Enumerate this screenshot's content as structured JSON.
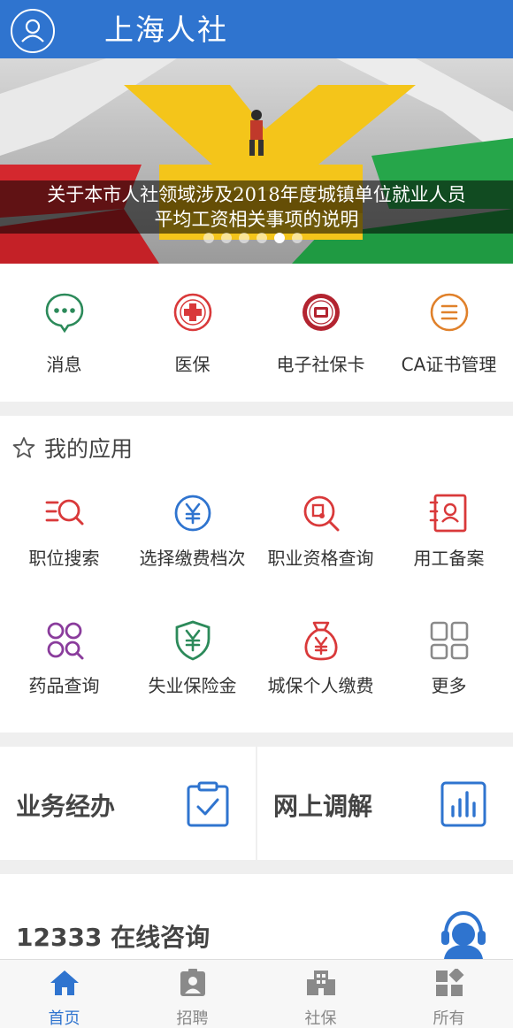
{
  "header": {
    "title": "上海人社",
    "avatar_icon": "user-icon"
  },
  "banner": {
    "caption_line1": "关于本市人社领域涉及2018年度城镇单位就业人员",
    "caption_line2": "平均工资相关事项的说明",
    "slide_count": 6,
    "active_slide": 4
  },
  "quick_actions": [
    {
      "label": "消息",
      "icon": "chat-bubble-icon",
      "color": "#2c8a5a"
    },
    {
      "label": "医保",
      "icon": "medical-cross-icon",
      "color": "#d9393a"
    },
    {
      "label": "电子社保卡",
      "icon": "social-security-seal-icon",
      "color": "#b32430"
    },
    {
      "label": "CA证书管理",
      "icon": "list-icon",
      "color": "#e0812b"
    }
  ],
  "my_apps": {
    "title": "我的应用",
    "icon": "star-icon",
    "items": [
      {
        "label": "职位搜索",
        "icon": "list-search-icon"
      },
      {
        "label": "选择缴费档次",
        "icon": "yuan-circle-icon"
      },
      {
        "label": "职业资格查询",
        "icon": "certificate-search-icon"
      },
      {
        "label": "用工备案",
        "icon": "id-card-icon"
      },
      {
        "label": "药品查询",
        "icon": "pills-search-icon"
      },
      {
        "label": "失业保险金",
        "icon": "yuan-shield-icon"
      },
      {
        "label": "城保个人缴费",
        "icon": "money-bag-icon"
      },
      {
        "label": "更多",
        "icon": "grid-icon"
      }
    ]
  },
  "services": [
    {
      "label": "业务经办",
      "icon": "clipboard-check-icon"
    },
    {
      "label": "网上调解",
      "icon": "bar-chart-icon"
    }
  ],
  "consult": {
    "label": "12333 在线咨询",
    "icon": "headset-agent-icon"
  },
  "tabbar": {
    "items": [
      {
        "label": "首页",
        "icon": "home-icon"
      },
      {
        "label": "招聘",
        "icon": "badge-icon"
      },
      {
        "label": "社保",
        "icon": "building-icon"
      },
      {
        "label": "所有",
        "icon": "apps-icon"
      }
    ],
    "active_index": 0
  },
  "colors": {
    "primary": "#2f74cf",
    "red": "#d9393a",
    "purple": "#8a3c9c",
    "green": "#2c8a5a",
    "gray": "#8a8a8a"
  }
}
